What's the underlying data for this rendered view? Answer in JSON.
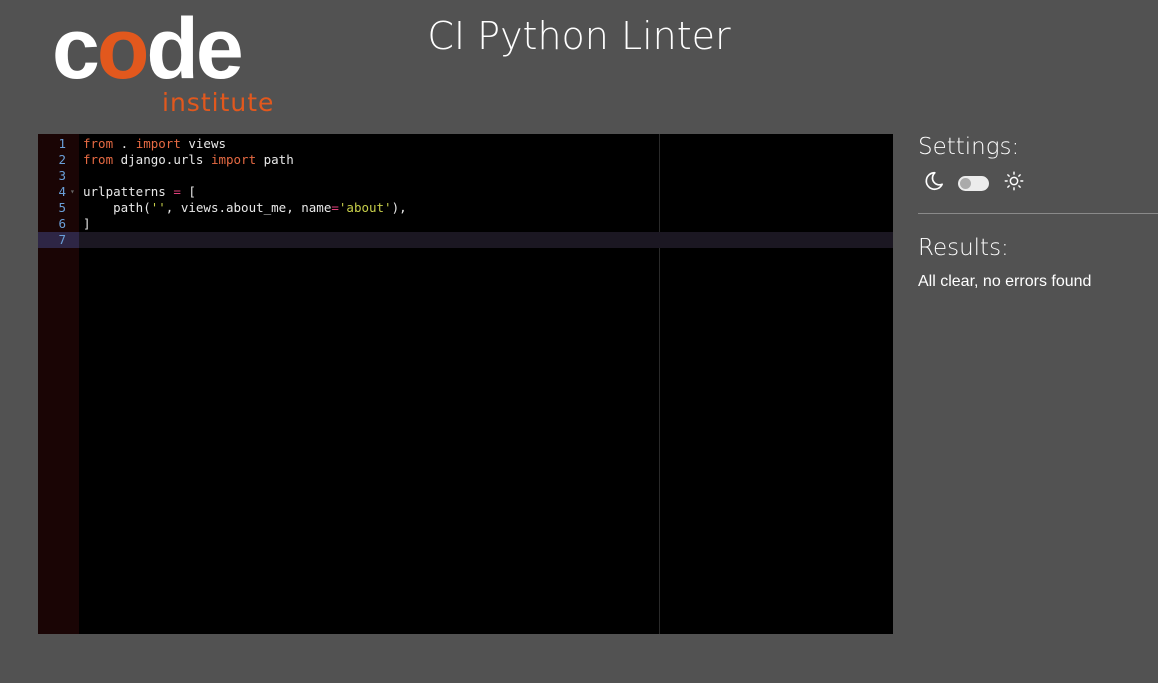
{
  "logo": {
    "word_prefix": "c",
    "word_o": "o",
    "word_suffix": "de",
    "sub": "institute"
  },
  "title": "CI Python Linter",
  "editor": {
    "active_line": 7,
    "lines": [
      {
        "n": "1",
        "tokens": [
          {
            "t": "from",
            "c": "kw"
          },
          {
            "t": " . ",
            "c": ""
          },
          {
            "t": "import",
            "c": "kw"
          },
          {
            "t": " views",
            "c": ""
          }
        ]
      },
      {
        "n": "2",
        "tokens": [
          {
            "t": "from",
            "c": "kw"
          },
          {
            "t": " django.urls ",
            "c": ""
          },
          {
            "t": "import",
            "c": "kw"
          },
          {
            "t": " path",
            "c": ""
          }
        ]
      },
      {
        "n": "3",
        "tokens": []
      },
      {
        "n": "4",
        "fold": true,
        "tokens": [
          {
            "t": "urlpatterns ",
            "c": ""
          },
          {
            "t": "=",
            "c": "op"
          },
          {
            "t": " [",
            "c": ""
          }
        ]
      },
      {
        "n": "5",
        "tokens": [
          {
            "t": "    path(",
            "c": ""
          },
          {
            "t": "''",
            "c": "str"
          },
          {
            "t": ", views.about_me, name",
            "c": ""
          },
          {
            "t": "=",
            "c": "op"
          },
          {
            "t": "'about'",
            "c": "str"
          },
          {
            "t": "),",
            "c": ""
          }
        ]
      },
      {
        "n": "6",
        "tokens": [
          {
            "t": "]",
            "c": ""
          }
        ]
      },
      {
        "n": "7",
        "tokens": []
      }
    ]
  },
  "settings": {
    "heading": "Settings:",
    "theme_toggle_on": false
  },
  "results": {
    "heading": "Results:",
    "message": "All clear, no errors found"
  }
}
